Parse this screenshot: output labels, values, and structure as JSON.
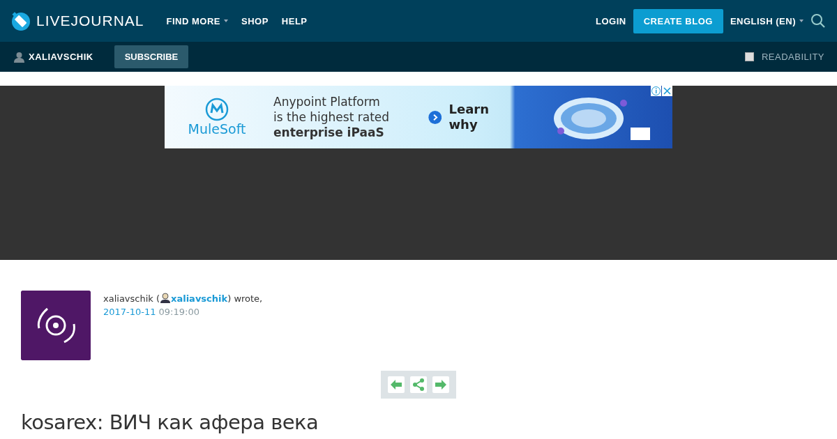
{
  "header": {
    "logo": "LIVEJOURNAL",
    "nav": [
      {
        "label": "FIND MORE",
        "dropdown": true
      },
      {
        "label": "SHOP",
        "dropdown": false
      },
      {
        "label": "HELP",
        "dropdown": false
      }
    ],
    "login": "LOGIN",
    "create_blog": "CREATE BLOG",
    "language": "ENGLISH (EN)"
  },
  "journal_bar": {
    "username": "XALIAVSCHIK",
    "subscribe": "SUBSCRIBE",
    "readability": {
      "label": "READABILITY",
      "checked": false
    }
  },
  "ad": {
    "brand": "MuleSoft",
    "headline": [
      "Anypoint Platform",
      "is the highest rated",
      "enterprise iPaaS"
    ],
    "cta": "Learn why"
  },
  "entry": {
    "author": "xaliavschik (",
    "user_link": "xaliavschik",
    "wrote": ") wrote,",
    "date": "2017-10-11",
    "time": "09:19:00",
    "title": "kosarex: ВИЧ как афера века"
  }
}
